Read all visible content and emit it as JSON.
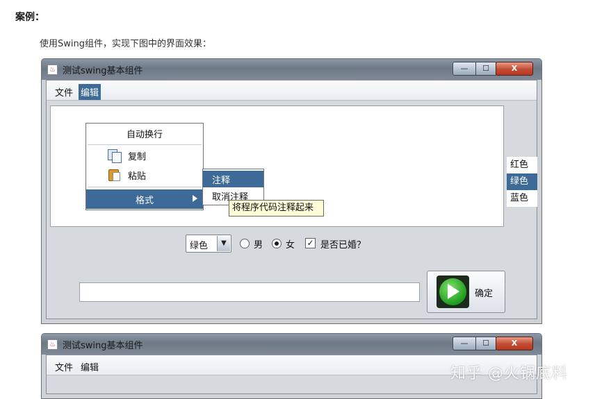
{
  "article": {
    "heading": "案例：",
    "intro": "使用Swing组件，实现下图中的界面效果："
  },
  "window1": {
    "title": "测试swing基本组件",
    "controls": {
      "minimize": "—",
      "maximize": "☐",
      "close": "X"
    },
    "menubar": [
      "文件",
      "编辑"
    ],
    "active_menu": "编辑",
    "edit_menu": {
      "items": [
        {
          "label": "自动换行"
        },
        {
          "label": "复制",
          "icon": "copy-icon"
        },
        {
          "label": "粘贴",
          "icon": "paste-icon"
        },
        {
          "label": "格式",
          "has_submenu": true
        }
      ]
    },
    "format_submenu": [
      "注释",
      "取消注释"
    ],
    "tooltip": "将程序代码注释起来",
    "color_list": {
      "items": [
        "红色",
        "绿色",
        "蓝色"
      ],
      "selected": "绿色"
    },
    "combo": {
      "value": "绿色"
    },
    "gender": {
      "male": "男",
      "female": "女",
      "selected": "女"
    },
    "married": {
      "label": "是否已婚？",
      "checked": true
    },
    "ok_button": {
      "label": "确定",
      "icon": "play-icon"
    },
    "accent_color": "#3d6a96"
  },
  "window2": {
    "title": "测试swing基本组件",
    "menubar": [
      "文件",
      "编辑"
    ]
  },
  "watermark": "知乎 @火锅底料"
}
